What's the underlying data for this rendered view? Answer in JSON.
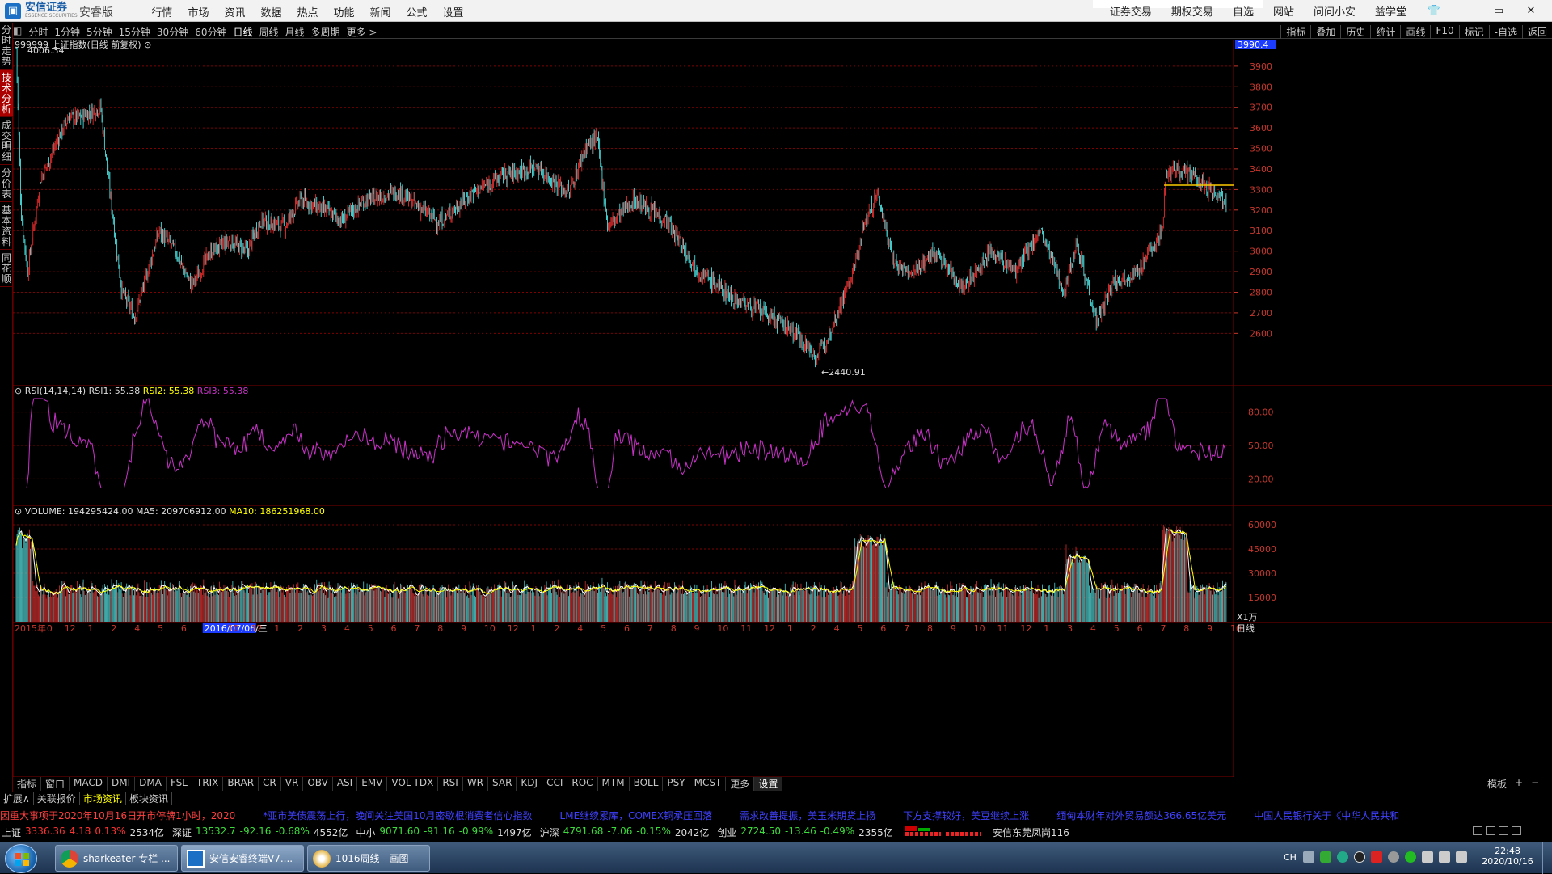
{
  "app": {
    "brand_name": "安信证券",
    "brand_sub": "ESSENCE SECURITIES",
    "edition": "安睿版",
    "menu": [
      "行情",
      "市场",
      "资讯",
      "数据",
      "热点",
      "功能",
      "新闻",
      "公式",
      "设置"
    ],
    "right_menu": [
      "证券交易",
      "期权交易",
      "自选",
      "网站",
      "问问小安",
      "益学堂"
    ],
    "win_controls": [
      "▼",
      "—",
      "▭",
      "✕"
    ]
  },
  "toolbar": {
    "periods": [
      "分时",
      "1分钟",
      "5分钟",
      "15分钟",
      "30分钟",
      "60分钟",
      "日线",
      "周线",
      "月线",
      "多周期",
      "更多 >"
    ],
    "active_period": "日线",
    "right_buttons": [
      "指标",
      "叠加",
      "历史",
      "统计",
      "画线",
      "F10",
      "标记",
      "-自选",
      "返回"
    ]
  },
  "side_tabs": [
    "分时走势",
    "技术分析",
    "成交明细",
    "分价表",
    "基本资料",
    "同花顺"
  ],
  "side_tab_active": "技术分析",
  "main_chart": {
    "title": "999999 上证指数(日线 前复权)",
    "high_label": "4006.34",
    "low_label": "2440.91",
    "current_price_tag": "3990.4",
    "y_ticks": [
      "3900",
      "3800",
      "3700",
      "3600",
      "3500",
      "3400",
      "3300",
      "3200",
      "3100",
      "3000",
      "2900",
      "2800",
      "2700",
      "2600"
    ]
  },
  "rsi_panel": {
    "name": "RSI(14,14,14)",
    "rsi1": "RSI1: 55.38",
    "rsi2": "RSI2: 55.38",
    "rsi3": "RSI3: 55.38",
    "y_ticks": [
      "80.00",
      "50.00",
      "20.00"
    ]
  },
  "volume_panel": {
    "volume": "VOLUME: 194295424.00",
    "ma5": "MA5: 209706912.00",
    "ma10": "MA10: 186251968.00",
    "y_ticks": [
      "60000",
      "45000",
      "30000",
      "15000"
    ],
    "unit": "X1万"
  },
  "x_axis": {
    "labels": [
      "2015年",
      "10",
      "12",
      "1",
      "2",
      "4",
      "5",
      "6",
      "2016/07/06/三",
      "10",
      "12",
      "1",
      "2",
      "3",
      "4",
      "5",
      "6",
      "7",
      "8",
      "9",
      "10",
      "12",
      "1",
      "2",
      "4",
      "5",
      "6",
      "7",
      "8",
      "9",
      "10",
      "11",
      "12",
      "1",
      "2",
      "4",
      "5",
      "6",
      "7",
      "8",
      "9",
      "10",
      "11",
      "12",
      "1",
      "3",
      "4",
      "5",
      "6",
      "7",
      "8",
      "9",
      "10"
    ],
    "period_label": "日线"
  },
  "indicator_tabs": [
    "指标",
    "窗口",
    "MACD",
    "DMI",
    "DMA",
    "FSL",
    "TRIX",
    "BRAR",
    "CR",
    "VR",
    "OBV",
    "ASI",
    "EMV",
    "VOL-TDX",
    "RSI",
    "WR",
    "SAR",
    "KDJ",
    "CCI",
    "ROC",
    "MTM",
    "BOLL",
    "PSY",
    "MCST",
    "更多",
    "设置"
  ],
  "indicator_right": [
    "模板",
    "+",
    "−"
  ],
  "bottom_tabs": [
    "扩展∧",
    "关联报价",
    "市场资讯",
    "板块资讯"
  ],
  "news": [
    "因重大事项于2020年10月16日开市停牌1小时，2020",
    "*亚市美债震荡上行，晚间关注美国10月密歇根消费者信心指数",
    "LME继续累库，COMEX铜承压回落",
    "需求改善提振，美玉米期货上扬",
    "下方支撑较好，美豆继续上涨",
    "缅甸本财年对外贸易额达366.65亿美元",
    "中国人民银行关于《中华人民共和"
  ],
  "quotes": [
    {
      "name": "上证",
      "price": "3336.36",
      "chg": "4.18",
      "pct": "0.13%",
      "amt": "2534亿"
    },
    {
      "name": "深证",
      "price": "13532.7",
      "chg": "-92.16",
      "pct": "-0.68%",
      "amt": "4552亿"
    },
    {
      "name": "中小",
      "price": "9071.60",
      "chg": "-91.16",
      "pct": "-0.99%",
      "amt": "1497亿"
    },
    {
      "name": "沪深",
      "price": "4791.68",
      "chg": "-7.06",
      "pct": "-0.15%",
      "amt": "2042亿"
    },
    {
      "name": "创业",
      "price": "2724.50",
      "chg": "-13.46",
      "pct": "-0.49%",
      "amt": "2355亿"
    }
  ],
  "broker_label": "安信东莞凤岗116",
  "taskbar": {
    "items": [
      "sharkeater 专栏 ...",
      "安信安睿终端V7....",
      "1016周线 - 画图"
    ],
    "lang": "CH",
    "time": "22:48",
    "date": "2020/10/16"
  },
  "colors": {
    "up": "#ff3232",
    "down": "#54fcfc",
    "rsi": "#c832c8",
    "ma5": "#ffffff",
    "ma10": "#ffff00",
    "grid": "#800000",
    "price_tag": "#1c3cff"
  }
}
